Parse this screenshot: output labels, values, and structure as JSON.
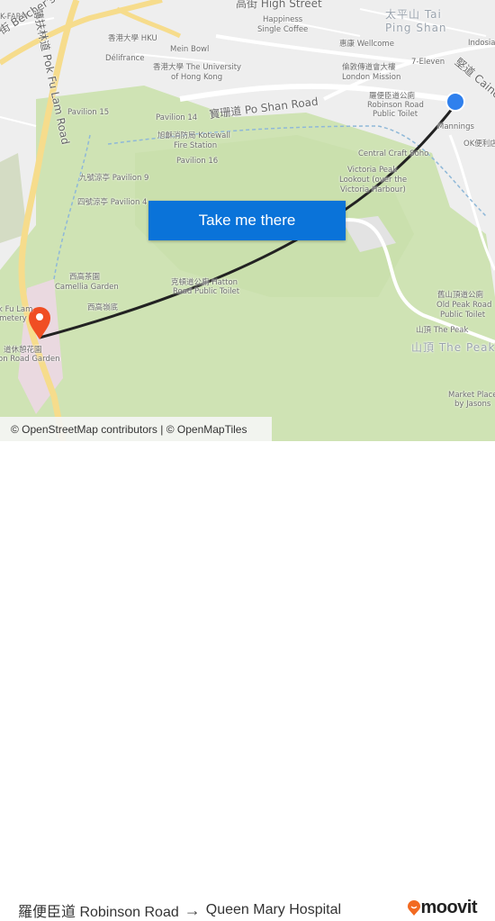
{
  "map": {
    "labels": [
      "K-FARM",
      "街 Belcher's Stre",
      "薄扶林道 Pok Fu Lam Road",
      "香港大學 HKU",
      "Mein Bowl",
      "Délifrance",
      "香港大學 The University",
      "of Hong Kong",
      "Pavilion 15",
      "Pavilion 14",
      "寶珊道 Po Shan Road",
      "旭龢消防局 Kotewall",
      "Fire Station",
      "Pavilion 16",
      "九號涼亭 Pavilion 9",
      "四號涼亭 Pavilion 4",
      "高街 High Street",
      "Happiness",
      "Single Coffee",
      "太平山 Tai",
      "Ping Shan",
      "Indosia",
      "惠康 Wellcome",
      "7-Eleven",
      "倫敦傳道會大樓",
      "London Mission",
      "羅便臣道公廁",
      "Robinson Road",
      "Public Toilet",
      "Mannings",
      "OK便利店",
      "Central Craft Soho",
      "Victoria Peak",
      "Lookout (over the",
      "Victoria Harbour)",
      "西高茶園",
      "Camellia Garden",
      "克頓道公廁 Hatton",
      "Road Public Toilet",
      "西高嶺底",
      "舊山頂道公廁",
      "Old Peak Road",
      "Public Toilet",
      "山頂 The Peak",
      "山頂 The Peak",
      "Market Place",
      "by Jasons",
      "Pok Fu Lam",
      "Cemetery",
      "道休憩花園",
      "on Road Garden",
      "堅道 Caine"
    ],
    "origin_marker_color": "#2f80ed",
    "destination_marker_color": "#f04e23",
    "route_color": "#222222",
    "cta_label": "Take me there",
    "attribution": "© OpenStreetMap contributors | © OpenMapTiles"
  },
  "footer": {
    "origin": "羅便臣道 Robinson Road",
    "arrow": "→",
    "destination": "Queen Mary Hospital",
    "brand": "moovit",
    "brand_color": "#f26a21"
  }
}
